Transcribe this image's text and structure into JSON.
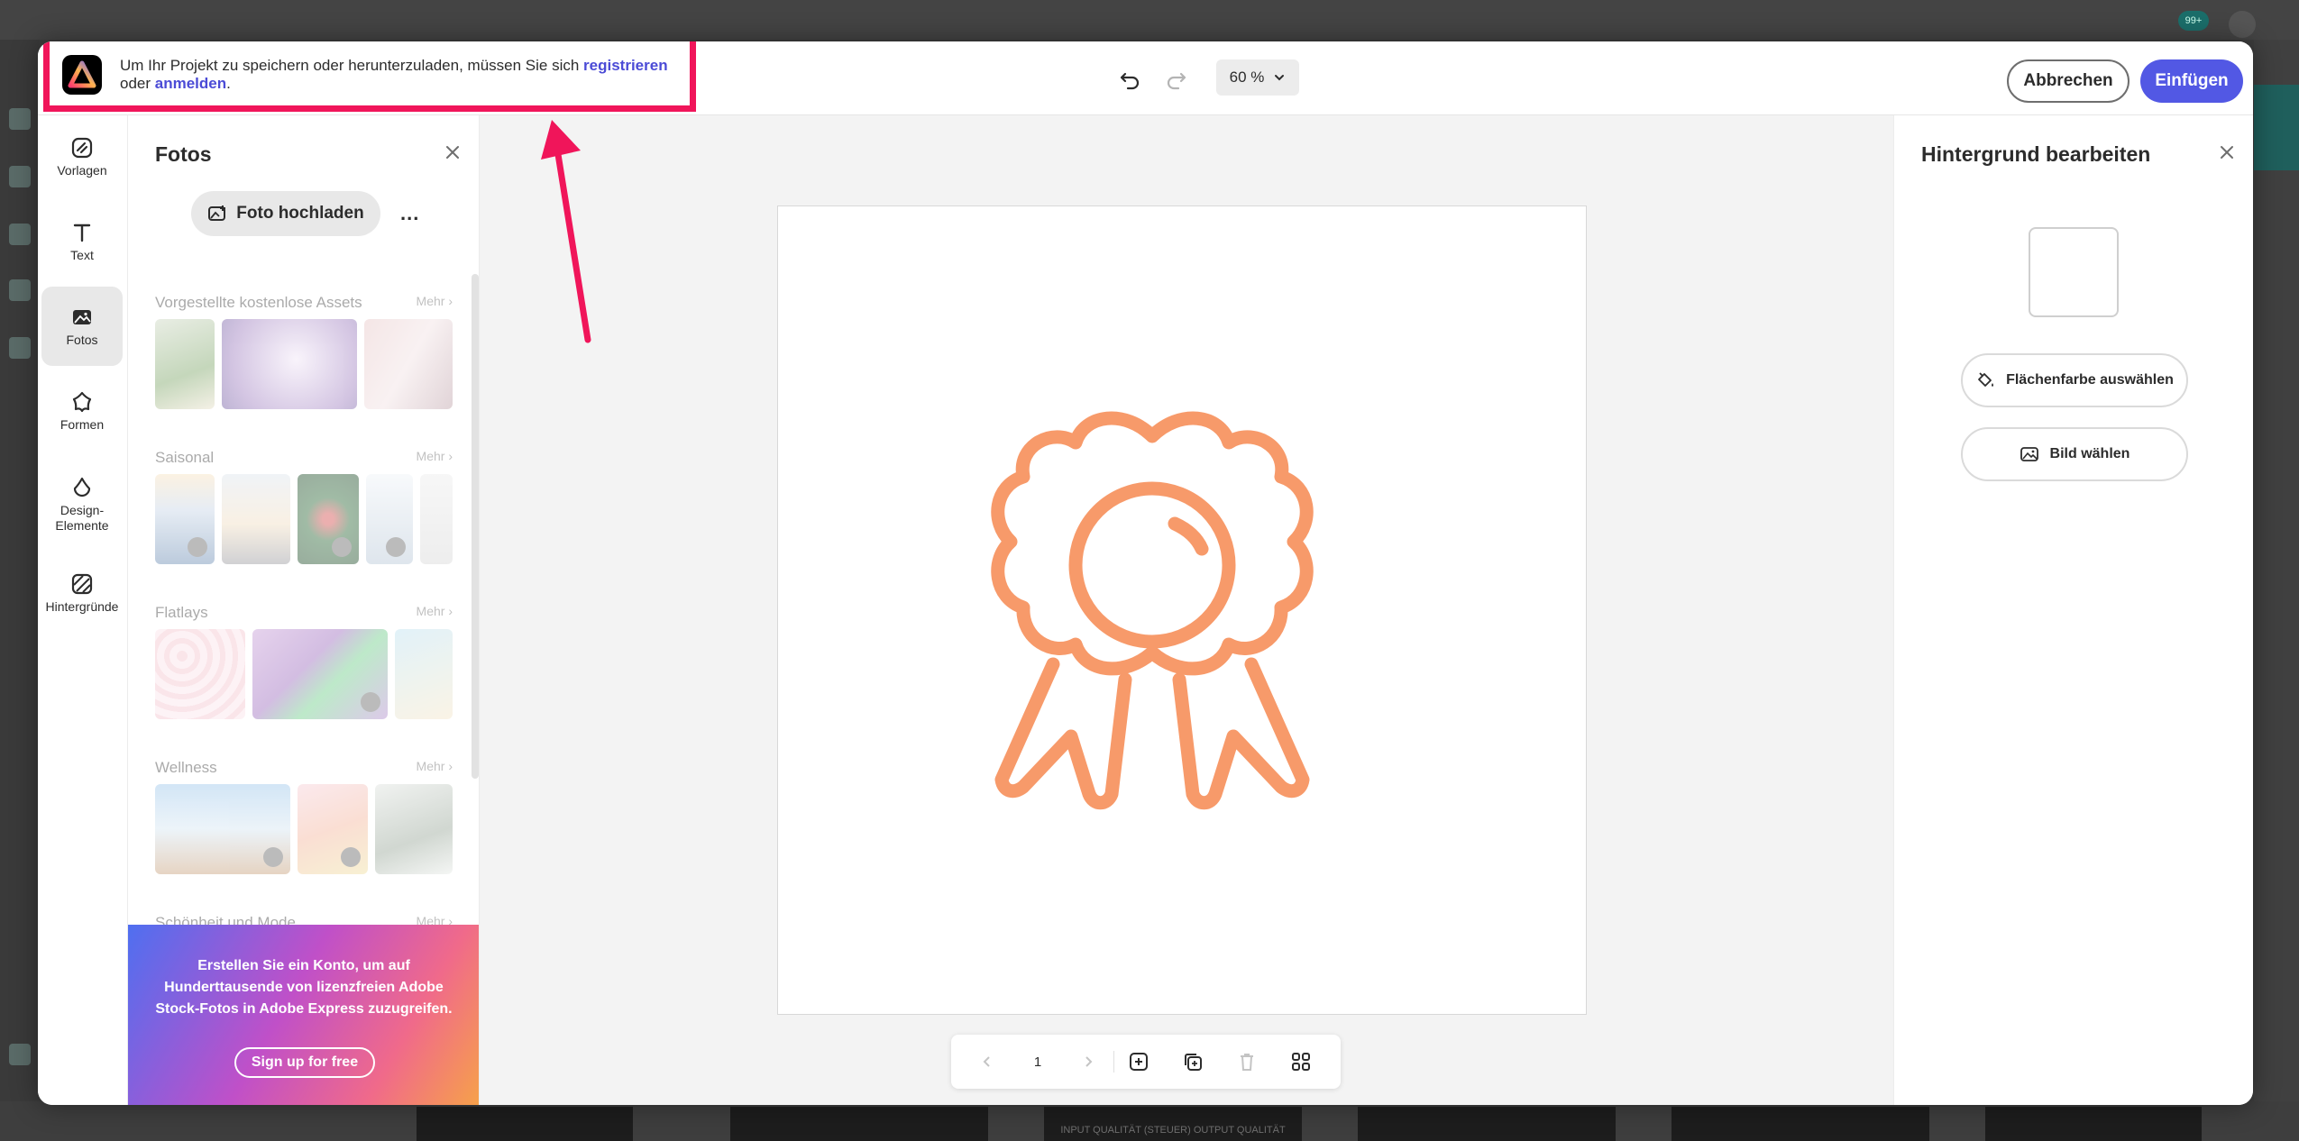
{
  "background": {
    "badge": "99+",
    "thumb_label": "INPUT QUALITÄT (STEUER) OUTPUT QUALITÄT"
  },
  "notice": {
    "prefix": "Um Ihr Projekt zu speichern oder herunterzuladen, müssen Sie sich ",
    "register_link": "registrieren",
    "middle": " oder ",
    "login_link": "anmelden",
    "suffix": "."
  },
  "toolbar": {
    "zoom": "60 %",
    "cancel_label": "Abbrechen",
    "insert_label": "Einfügen"
  },
  "rail": {
    "items": [
      {
        "label": "Vorlagen",
        "icon": "templates-icon"
      },
      {
        "label": "Text",
        "icon": "text-icon"
      },
      {
        "label": "Fotos",
        "icon": "photos-icon"
      },
      {
        "label": "Formen",
        "icon": "shapes-icon"
      },
      {
        "label": "Design-Elemente",
        "icon": "design-elements-icon"
      },
      {
        "label": "Hintergründe",
        "icon": "backgrounds-icon"
      }
    ]
  },
  "photos": {
    "title": "Fotos",
    "upload_label": "Foto hochladen",
    "more_dots": "...",
    "sections": [
      {
        "title": "Vorgestellte kostenlose Assets",
        "more": "Mehr ›"
      },
      {
        "title": "Saisonal",
        "more": "Mehr ›"
      },
      {
        "title": "Flatlays",
        "more": "Mehr ›"
      },
      {
        "title": "Wellness",
        "more": "Mehr ›"
      },
      {
        "title": "Schönheit und Mode",
        "more": "Mehr ›"
      }
    ],
    "promo_text": "Erstellen Sie ein Konto, um auf Hunderttausende von lizenzfreien Adobe Stock-Fotos in Adobe Express zuzugreifen.",
    "promo_button": "Sign up for free"
  },
  "canvas": {
    "page_number": "1",
    "graphic_color": "#f79a6a"
  },
  "right_panel": {
    "title": "Hintergrund bearbeiten",
    "fill_color_label": "Flächenfarbe auswählen",
    "image_label": "Bild wählen"
  },
  "colors": {
    "accent": "#5258e4",
    "highlight": "#f0155a",
    "link": "#4b4bd6"
  }
}
